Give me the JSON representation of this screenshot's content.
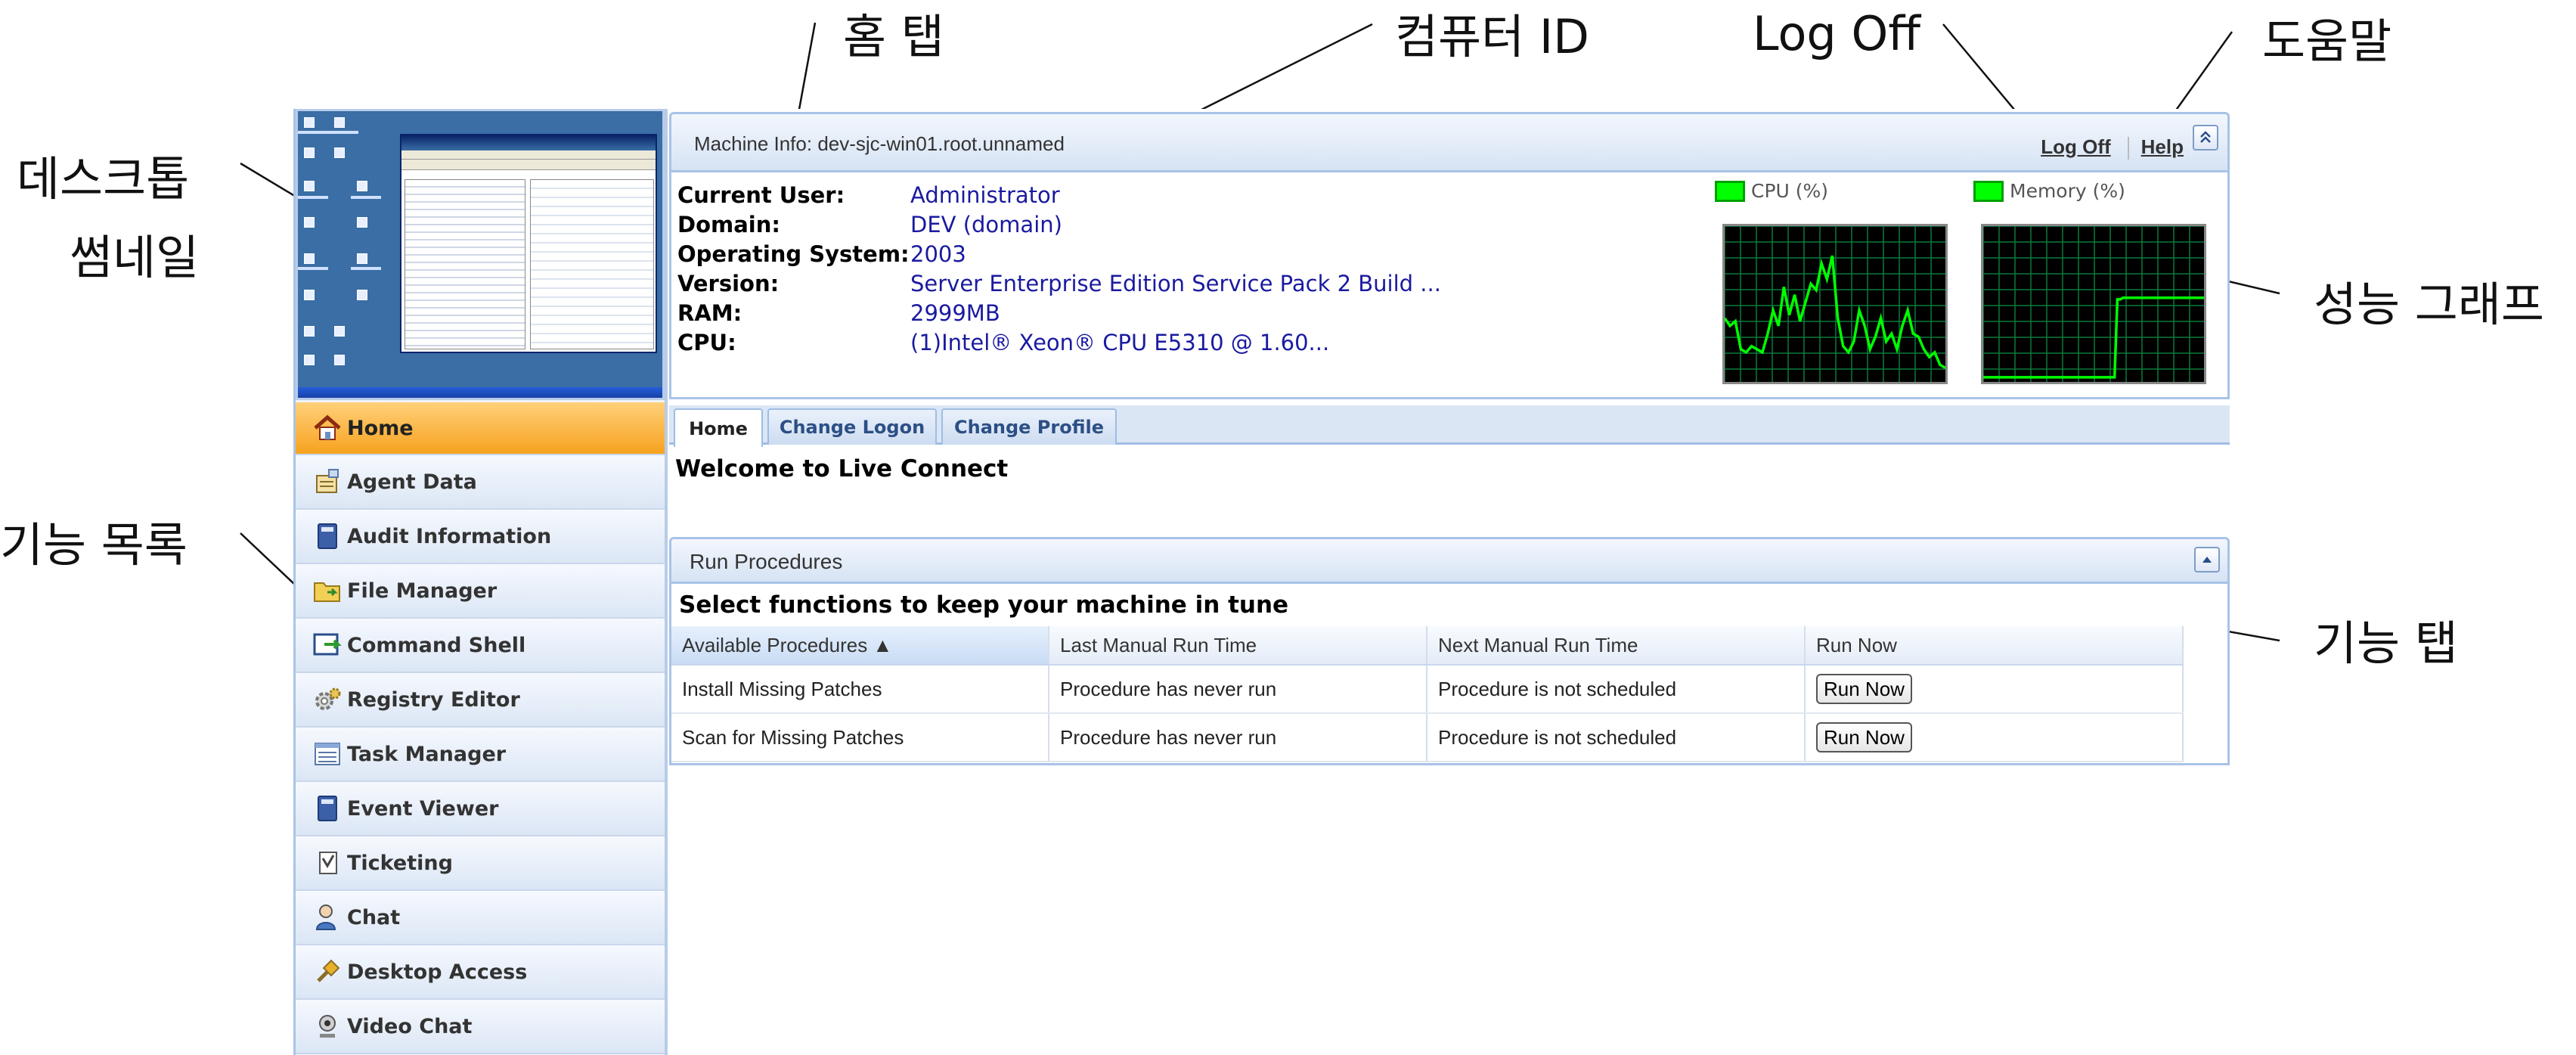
{
  "annotations": {
    "home_tab": "홈 탭",
    "computer_id": "컴퓨터 ID",
    "log_off": "Log Off",
    "help": "도움말",
    "desktop_thumbnail_line1": "데스크톱",
    "desktop_thumbnail_line2": "썸네일",
    "function_list": "기능 목록",
    "performance_graph": "성능 그래프",
    "function_tabs": "기능 탭"
  },
  "sidebar": {
    "items": [
      {
        "label": "Home",
        "icon": "house-icon",
        "active": true
      },
      {
        "label": "Agent Data",
        "icon": "agent-data-icon"
      },
      {
        "label": "Audit Information",
        "icon": "book-icon"
      },
      {
        "label": "File Manager",
        "icon": "folder-icon"
      },
      {
        "label": "Command Shell",
        "icon": "command-shell-icon"
      },
      {
        "label": "Registry Editor",
        "icon": "gears-icon"
      },
      {
        "label": "Task Manager",
        "icon": "task-list-icon"
      },
      {
        "label": "Event Viewer",
        "icon": "book-icon"
      },
      {
        "label": "Ticketing",
        "icon": "ticket-icon"
      },
      {
        "label": "Chat",
        "icon": "chat-user-icon"
      },
      {
        "label": "Desktop Access",
        "icon": "plug-icon"
      },
      {
        "label": "Video Chat",
        "icon": "webcam-icon"
      }
    ]
  },
  "header": {
    "machine_info": "Machine Info: dev-sjc-win01.root.unnamed",
    "log_off": "Log Off",
    "help": "Help"
  },
  "machine": {
    "rows": [
      {
        "label": "Current User:",
        "value": "Administrator"
      },
      {
        "label": "Domain:",
        "value": "DEV (domain)"
      },
      {
        "label": "Operating System:",
        "value": "2003"
      },
      {
        "label": "Version:",
        "value": "Server Enterprise Edition Service Pack 2 Build ..."
      },
      {
        "label": "RAM:",
        "value": "2999MB"
      },
      {
        "label": "CPU:",
        "value": "(1)Intel® Xeon® CPU E5310 @ 1.60..."
      }
    ]
  },
  "graphs": {
    "cpu_label": "CPU (%)",
    "memory_label": "Memory (%)",
    "line_color": "#00ff00",
    "cpu_values": [
      40,
      35,
      38,
      20,
      18,
      22,
      20,
      18,
      30,
      45,
      35,
      60,
      42,
      55,
      38,
      50,
      62,
      58,
      75,
      65,
      80,
      40,
      22,
      18,
      25,
      45,
      35,
      20,
      28,
      40,
      25,
      30,
      20,
      35,
      45,
      30,
      28,
      20,
      15,
      18,
      10,
      8
    ],
    "memory_values": [
      2,
      2,
      2,
      2,
      2,
      2,
      2,
      2,
      2,
      2,
      2,
      2,
      2,
      2,
      2,
      2,
      2,
      2,
      2,
      2,
      2,
      2,
      2,
      2,
      2,
      2,
      2,
      2,
      2,
      2,
      2,
      2,
      2,
      2,
      2,
      2,
      2,
      2,
      2,
      2,
      2,
      2,
      2,
      2,
      2,
      2,
      2,
      2,
      52,
      52,
      53,
      53,
      53,
      53,
      53,
      53,
      53,
      53,
      53,
      53,
      53,
      53,
      53,
      53,
      53,
      53,
      53,
      53,
      53,
      53,
      53,
      53,
      53,
      53,
      53,
      53,
      53,
      53,
      53,
      53
    ]
  },
  "tabs": [
    "Home",
    "Change Logon",
    "Change Profile"
  ],
  "home": {
    "welcome": "Welcome to Live Connect"
  },
  "procedures": {
    "title": "Run Procedures",
    "subtitle": "Select functions to keep your machine in tune",
    "columns": [
      "Available Procedures ▲",
      "Last Manual Run Time",
      "Next Manual Run Time",
      "Run Now"
    ],
    "rows": [
      {
        "name": "Install Missing Patches",
        "last": "Procedure has never run",
        "next": "Procedure is not scheduled",
        "button": "Run Now"
      },
      {
        "name": "Scan for Missing Patches",
        "last": "Procedure has never run",
        "next": "Procedure is not scheduled",
        "button": "Run Now"
      }
    ]
  }
}
